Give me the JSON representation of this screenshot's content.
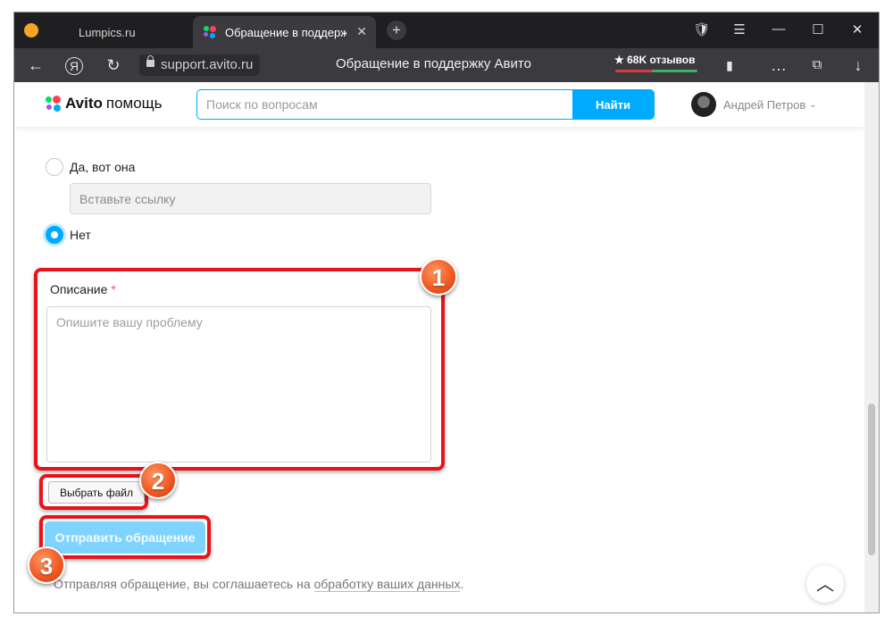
{
  "browser": {
    "tabs": [
      {
        "title": "Lumpics.ru"
      },
      {
        "title": "Обращение в поддержку Авито"
      }
    ],
    "url": "support.avito.ru",
    "page_title": "Обращение в поддержку Авито",
    "reviews": "★ 68K отзывов"
  },
  "header": {
    "logo_brand": "Avito",
    "logo_suffix": "помощь",
    "search_placeholder": "Поиск по вопросам",
    "search_button": "Найти",
    "user_name": "Андрей Петров"
  },
  "form": {
    "options": [
      {
        "label": "Да, вот она",
        "selected": false
      },
      {
        "label": "Нет",
        "selected": true
      }
    ],
    "link_placeholder": "Вставьте ссылку",
    "description_label": "Описание",
    "required_mark": "*",
    "description_placeholder": "Опишите вашу проблему",
    "file_button": "Выбрать файл",
    "submit_button": "Отправить обращение",
    "consent_text": "Отправляя обращение, вы соглашаетесь на",
    "consent_link": "обработку ваших данных",
    "consent_end": "."
  },
  "annotations": [
    "1",
    "2",
    "3"
  ],
  "colors": {
    "accent": "#00aaff",
    "highlight": "#e8131b",
    "badge": "#f15a24"
  }
}
